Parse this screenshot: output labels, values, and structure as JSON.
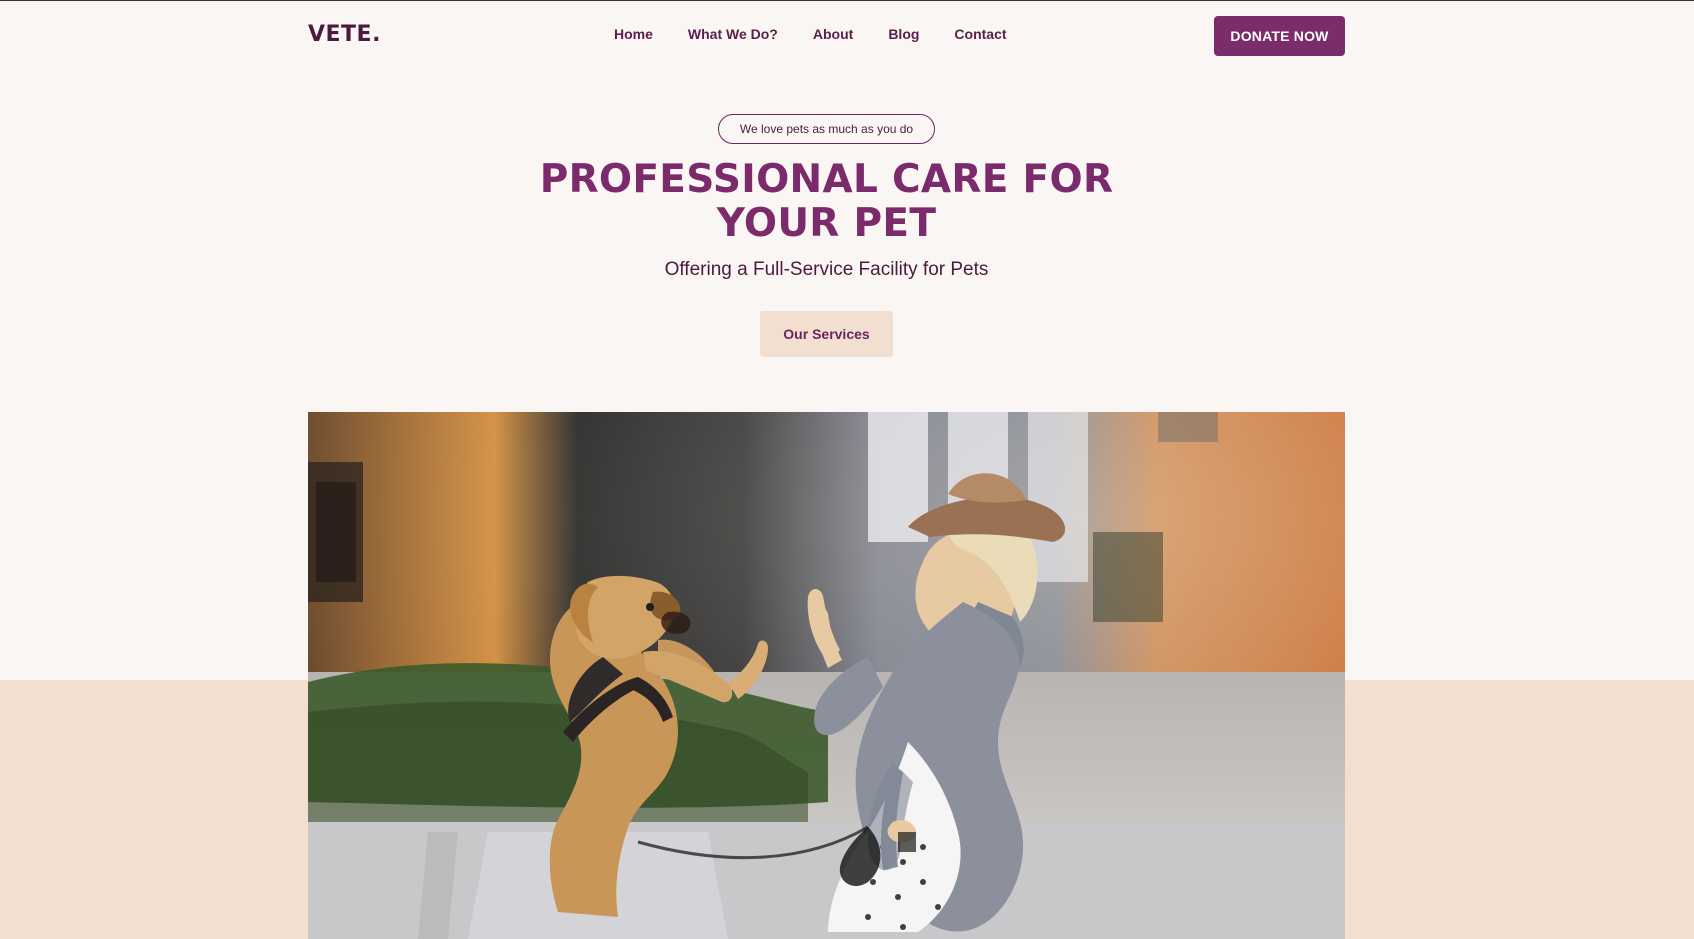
{
  "header": {
    "logo": "VETE.",
    "nav": [
      {
        "label": "Home"
      },
      {
        "label": "What We Do?"
      },
      {
        "label": "About"
      },
      {
        "label": "Blog"
      },
      {
        "label": "Contact"
      }
    ],
    "donate_label": "DONATE NOW"
  },
  "hero": {
    "tagline": "We love pets as much as you do",
    "title_line1": "PROFESSIONAL CARE FOR",
    "title_line2": "YOUR PET",
    "subtitle": "Offering a Full-Service Facility for Pets",
    "cta_label": "Our Services"
  },
  "colors": {
    "background": "#faf6f3",
    "band": "#f3dfcf",
    "accent": "#7a2d6a",
    "heading": "#7b2a6b",
    "text": "#4a1b3f"
  }
}
